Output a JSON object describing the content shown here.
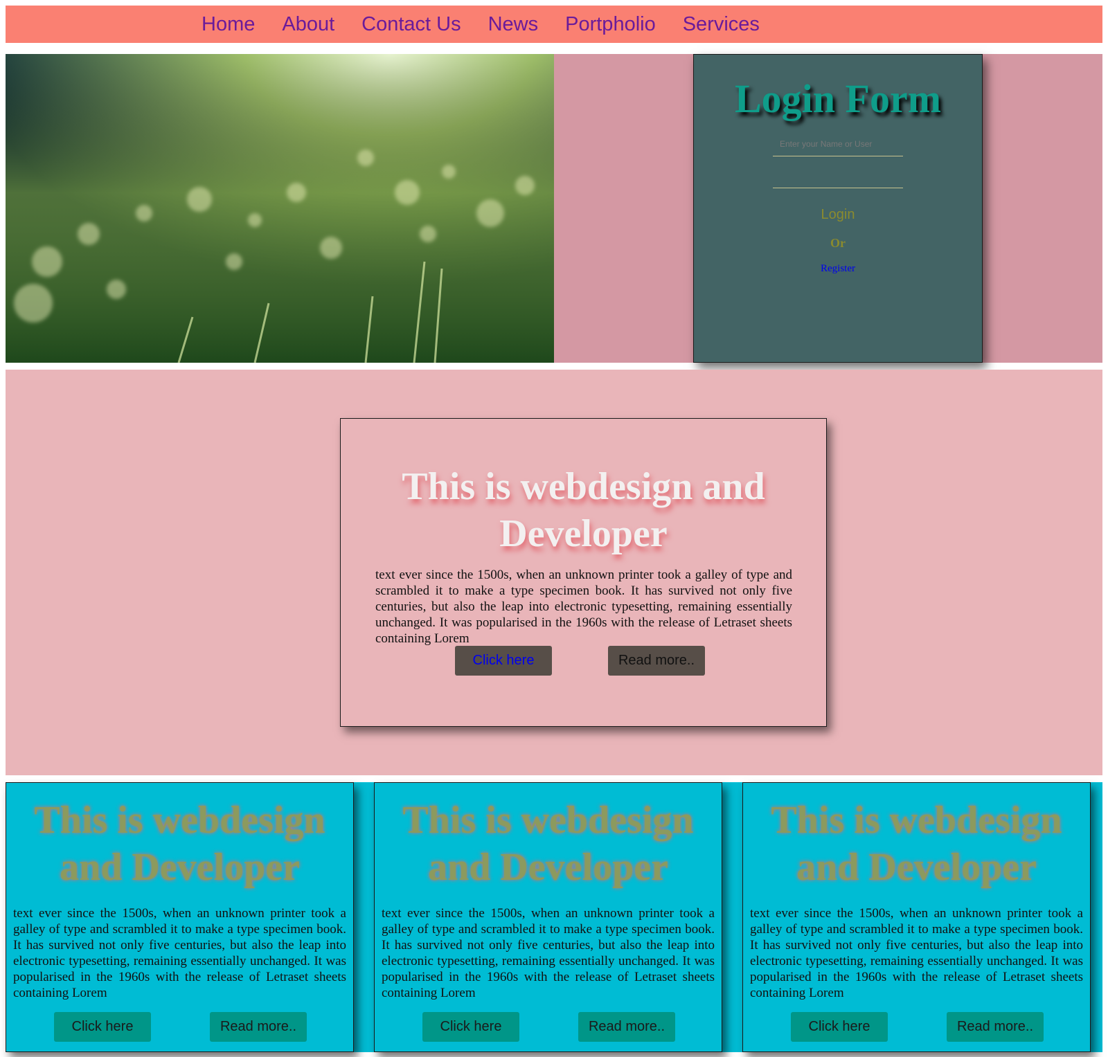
{
  "nav": {
    "items": [
      "Home",
      "About",
      "Contact Us",
      "News",
      "Portpholio",
      "Services"
    ]
  },
  "login": {
    "title": "Login Form",
    "username_placeholder": "Enter your Name or User",
    "password_value": "",
    "login_label": "Login",
    "or_label": "Or",
    "register_label": "Register"
  },
  "main_card": {
    "heading": "This is webdesign and Developer",
    "body": "text ever since the 1500s, when an unknown printer took a galley of type and scrambled it to make a type specimen book. It has survived not only five centuries, but also the leap into electronic typesetting, remaining essentially unchanged. It was popularised in the 1960s with the release of Letraset sheets containing Lorem",
    "click_label": "Click here",
    "read_label": "Read more.."
  },
  "cards": [
    {
      "heading": "This is webdesign and Developer",
      "body": "text ever since the 1500s, when an unknown printer took a galley of type and scrambled it to make a type specimen book. It has survived not only five centuries, but also the leap into electronic typesetting, remaining essentially unchanged. It was popularised in the 1960s with the release of Letraset sheets containing Lorem",
      "click_label": "Click here",
      "read_label": "Read more.."
    },
    {
      "heading": "This is webdesign and Developer",
      "body": "text ever since the 1500s, when an unknown printer took a galley of type and scrambled it to make a type specimen book. It has survived not only five centuries, but also the leap into electronic typesetting, remaining essentially unchanged. It was popularised in the 1960s with the release of Letraset sheets containing Lorem",
      "click_label": "Click here",
      "read_label": "Read more.."
    },
    {
      "heading": "This is webdesign and Developer",
      "body": "text ever since the 1500s, when an unknown printer took a galley of type and scrambled it to make a type specimen book. It has survived not only five centuries, but also the leap into electronic typesetting, remaining essentially unchanged. It was popularised in the 1960s with the release of Letraset sheets containing Lorem",
      "click_label": "Click here",
      "read_label": "Read more.."
    }
  ],
  "colors": {
    "nav_bg": "#fa8072",
    "nav_link": "#6a1b9a",
    "hero_bg": "#d498a3",
    "login_bg": "#436465",
    "login_title": "#0f9d8a",
    "section_bg": "#e9b5b9",
    "cards_bg": "#00bcd4",
    "button_dark": "#574e48",
    "button_teal": "#009688"
  }
}
